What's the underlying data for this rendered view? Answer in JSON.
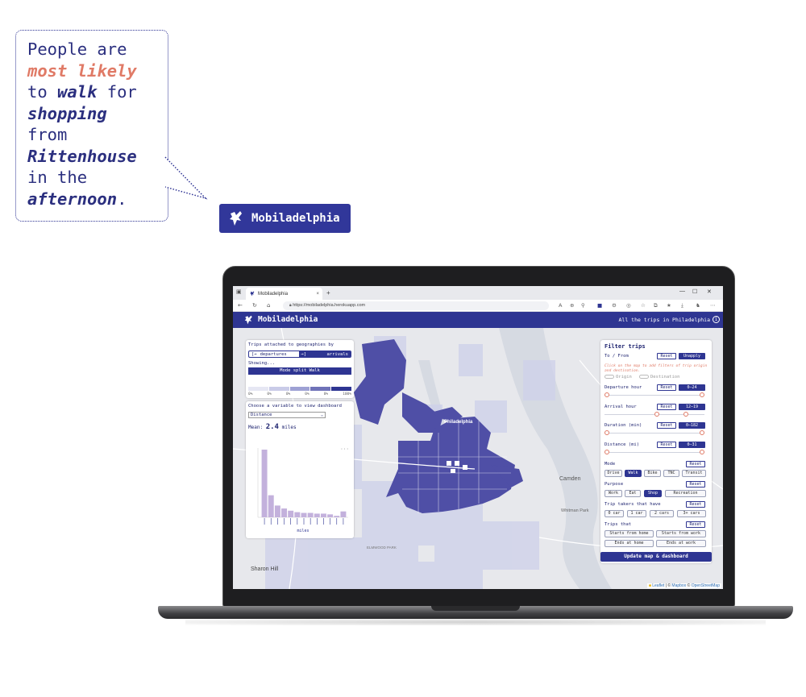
{
  "bubble": {
    "line1": "People are",
    "line2": "most likely",
    "line3a": "to ",
    "line3b": "walk",
    "line3c": " for",
    "line4": "shopping",
    "line5": "from",
    "line6": "Rittenhouse",
    "line7": "in the",
    "line8a": "afternoon",
    "line8b": "."
  },
  "brand": {
    "name": "Mobiladelphia"
  },
  "browser": {
    "tab_title": "Mobiladelphia",
    "tab_close": "×",
    "new_tab": "+",
    "minimize": "—",
    "maximize": "☐",
    "close": "✕",
    "url": "https://mobiladelphia.herokuapp.com"
  },
  "app": {
    "title": "Mobiladelphia",
    "context": "All the trips in Philadelphia",
    "info": "i"
  },
  "left_panel": {
    "title": "Trips attached to geographies by",
    "toggle_departures": "departures",
    "toggle_arrivals": "arrivals",
    "showing_label": "Showing...",
    "mode_split": "Mode split Walk",
    "scale_ticks": [
      "0%",
      "0%",
      "0%",
      "0%",
      "0%",
      "100%"
    ],
    "choose_label": "Choose a variable to view dashboard",
    "variable": "Distance",
    "mean_label": "Mean:",
    "mean_value": "2.4",
    "mean_unit": "miles",
    "more": "···"
  },
  "chart_data": {
    "type": "bar",
    "title": "",
    "xlabel": "miles",
    "ylabel": "",
    "values": [
      92,
      30,
      16,
      12,
      9,
      7,
      6,
      6,
      5,
      5,
      4,
      2,
      8
    ],
    "color": "#c3b1dc"
  },
  "filter": {
    "title": "Filter trips",
    "to_from": "To / From",
    "reset": "Reset",
    "unapply": "Unapply",
    "hint": "Click on the map to add filters of trip origin and destination.",
    "origin": "Origin",
    "destination": "Destination",
    "departure_hour": "Departure hour",
    "departure_range": "0–24",
    "arrival_hour": "Arrival hour",
    "arrival_range": "12–19",
    "duration": "Duration (min)",
    "duration_range": "0–182",
    "distance": "Distance (mi)",
    "distance_range": "0–31",
    "mode_label": "Mode",
    "modes": [
      "Drive",
      "Walk",
      "Bike",
      "TNC",
      "Transit"
    ],
    "purpose_label": "Purpose",
    "purposes": [
      "Work",
      "Eat",
      "Shop",
      "Recreation"
    ],
    "trip_takers_label": "Trip takers that have",
    "cars": [
      "0 car",
      "1 car",
      "2 cars",
      "3+ cars"
    ],
    "trips_that_label": "Trips that",
    "trips_that": [
      "Starts from home",
      "Starts from work",
      "Ends at home",
      "Ends at work"
    ],
    "update": "Update map & dashboard"
  },
  "map_labels": {
    "philadelphia": "Philadelphia",
    "camden": "Camden",
    "sharon_hill": "Sharon Hill",
    "whitman_park": "Whitman Park",
    "elmwood_park": "ELMWOOD PARK",
    "attrib_leaflet": "Leaflet",
    "attrib_sep": " | © ",
    "attrib_mapbox": "Mapbox",
    "attrib_osm_pre": " © ",
    "attrib_osm": "OpenStreetMap"
  },
  "colors": {
    "brand": "#2e3592",
    "accent": "#e07a66",
    "choropleth_dark": "#4f4fa6",
    "choropleth_light": "#cdd0ea"
  }
}
